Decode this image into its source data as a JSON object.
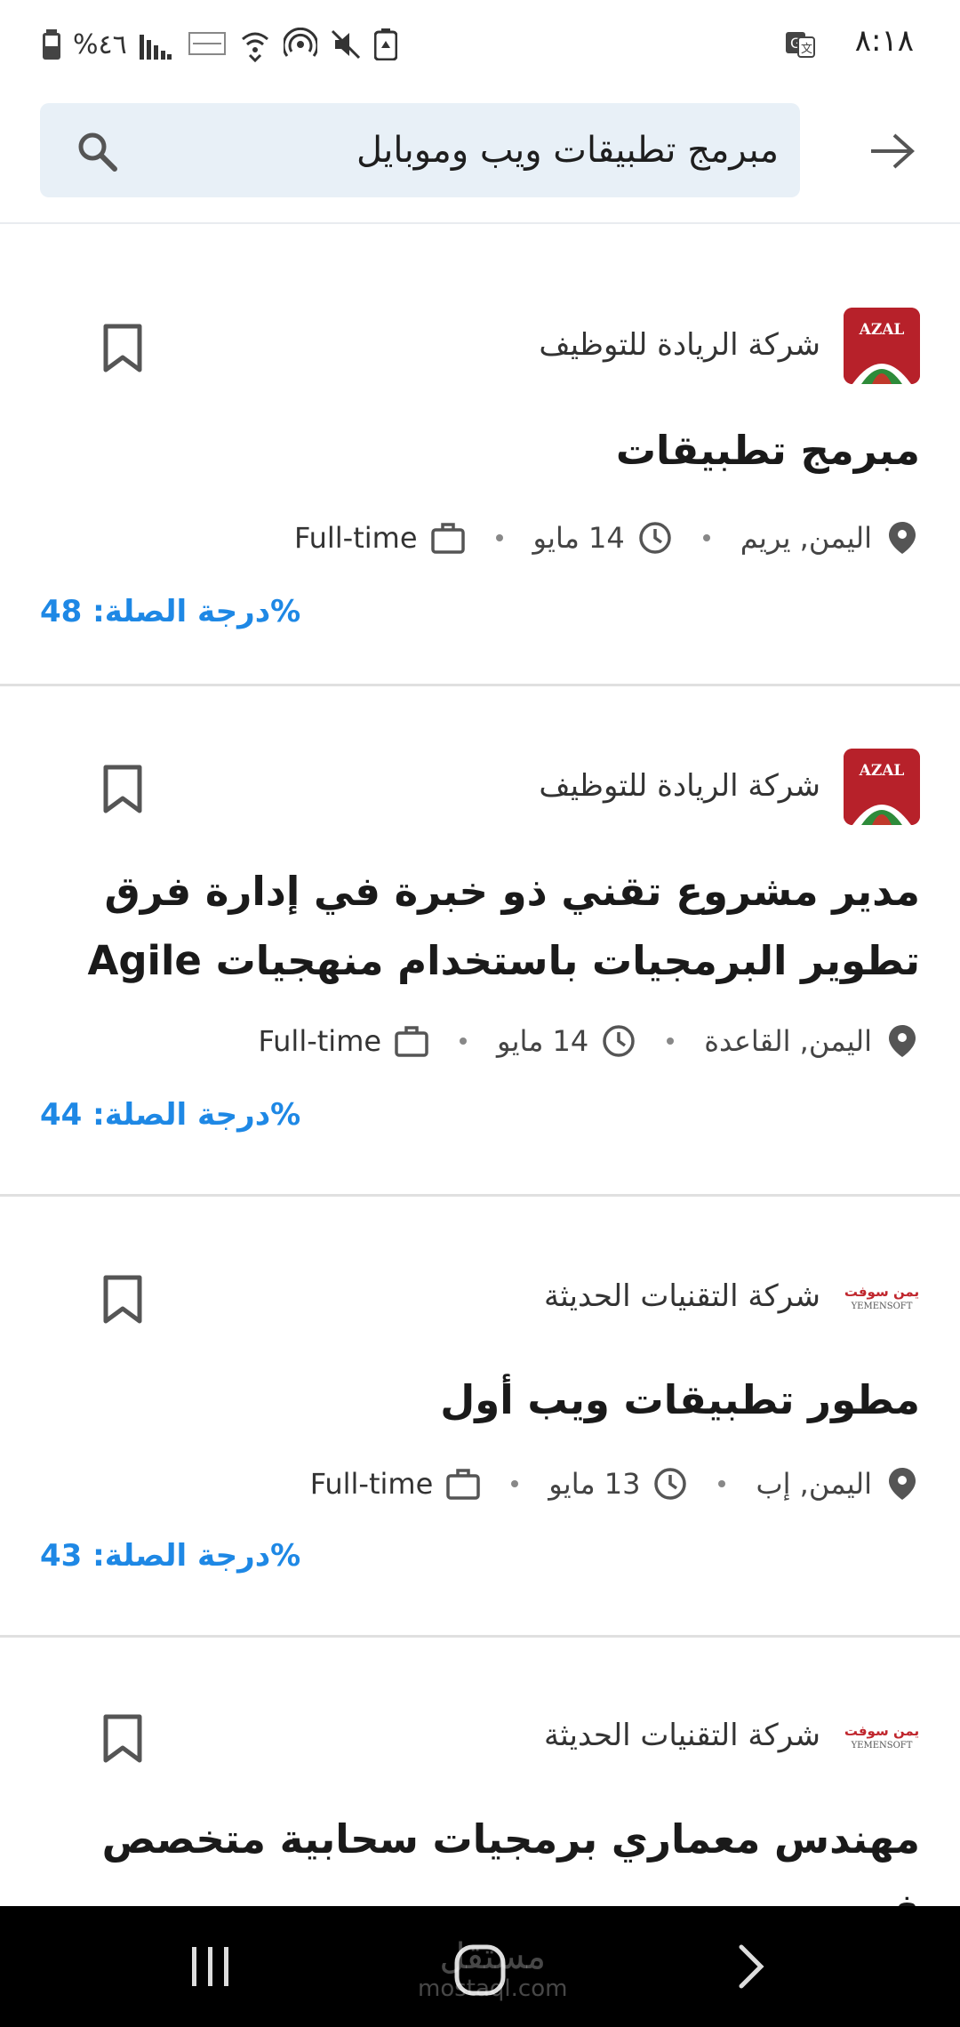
{
  "status_bar": {
    "time": "٨:١٨",
    "battery": "%٤٦"
  },
  "search": {
    "query": "مبرمج تطبيقات ويب وموبايل"
  },
  "jobs": [
    {
      "company": "شركة الريادة للتوظيف",
      "logo": "azal-logo",
      "logo_text": "AZAL",
      "title": "مبرمج تطبيقات",
      "location": "اليمن, يريم",
      "date": "14 مايو",
      "type": "Full-time",
      "score": "%درجة الصلة: 48"
    },
    {
      "company": "شركة الريادة للتوظيف",
      "logo": "azal-logo",
      "logo_text": "AZAL",
      "title": "مدير مشروع تقني ذو خبرة في إدارة فرق تطوير البرمجيات باستخدام منهجيات Agile",
      "location": "اليمن, القاعدة",
      "date": "14 مايو",
      "type": "Full-time",
      "score": "%درجة الصلة: 44"
    },
    {
      "company": "شركة التقنيات الحديثة",
      "logo": "yemensoft-logo",
      "logo_text": "يمن سوفت",
      "logo_sub": "YEMENSOFT",
      "title": "مطور تطبيقات ويب أول",
      "location": "اليمن, إب",
      "date": "13 مايو",
      "type": "Full-time",
      "score": "%درجة الصلة: 43"
    },
    {
      "company": "شركة التقنيات الحديثة",
      "logo": "yemensoft-logo",
      "logo_text": "يمن سوفت",
      "logo_sub": "YEMENSOFT",
      "title": "مهندس معماري برمجيات سحابية متخصص في",
      "location": "",
      "date": "",
      "type": "",
      "score": ""
    }
  ],
  "watermark": {
    "arabic": "مستقل",
    "latin": "mostaql.com"
  },
  "colors": {
    "accent": "#1e88e5",
    "search_bg": "#e8f0f7",
    "azal_red": "#b7212a",
    "divider": "#e0e0e0"
  }
}
